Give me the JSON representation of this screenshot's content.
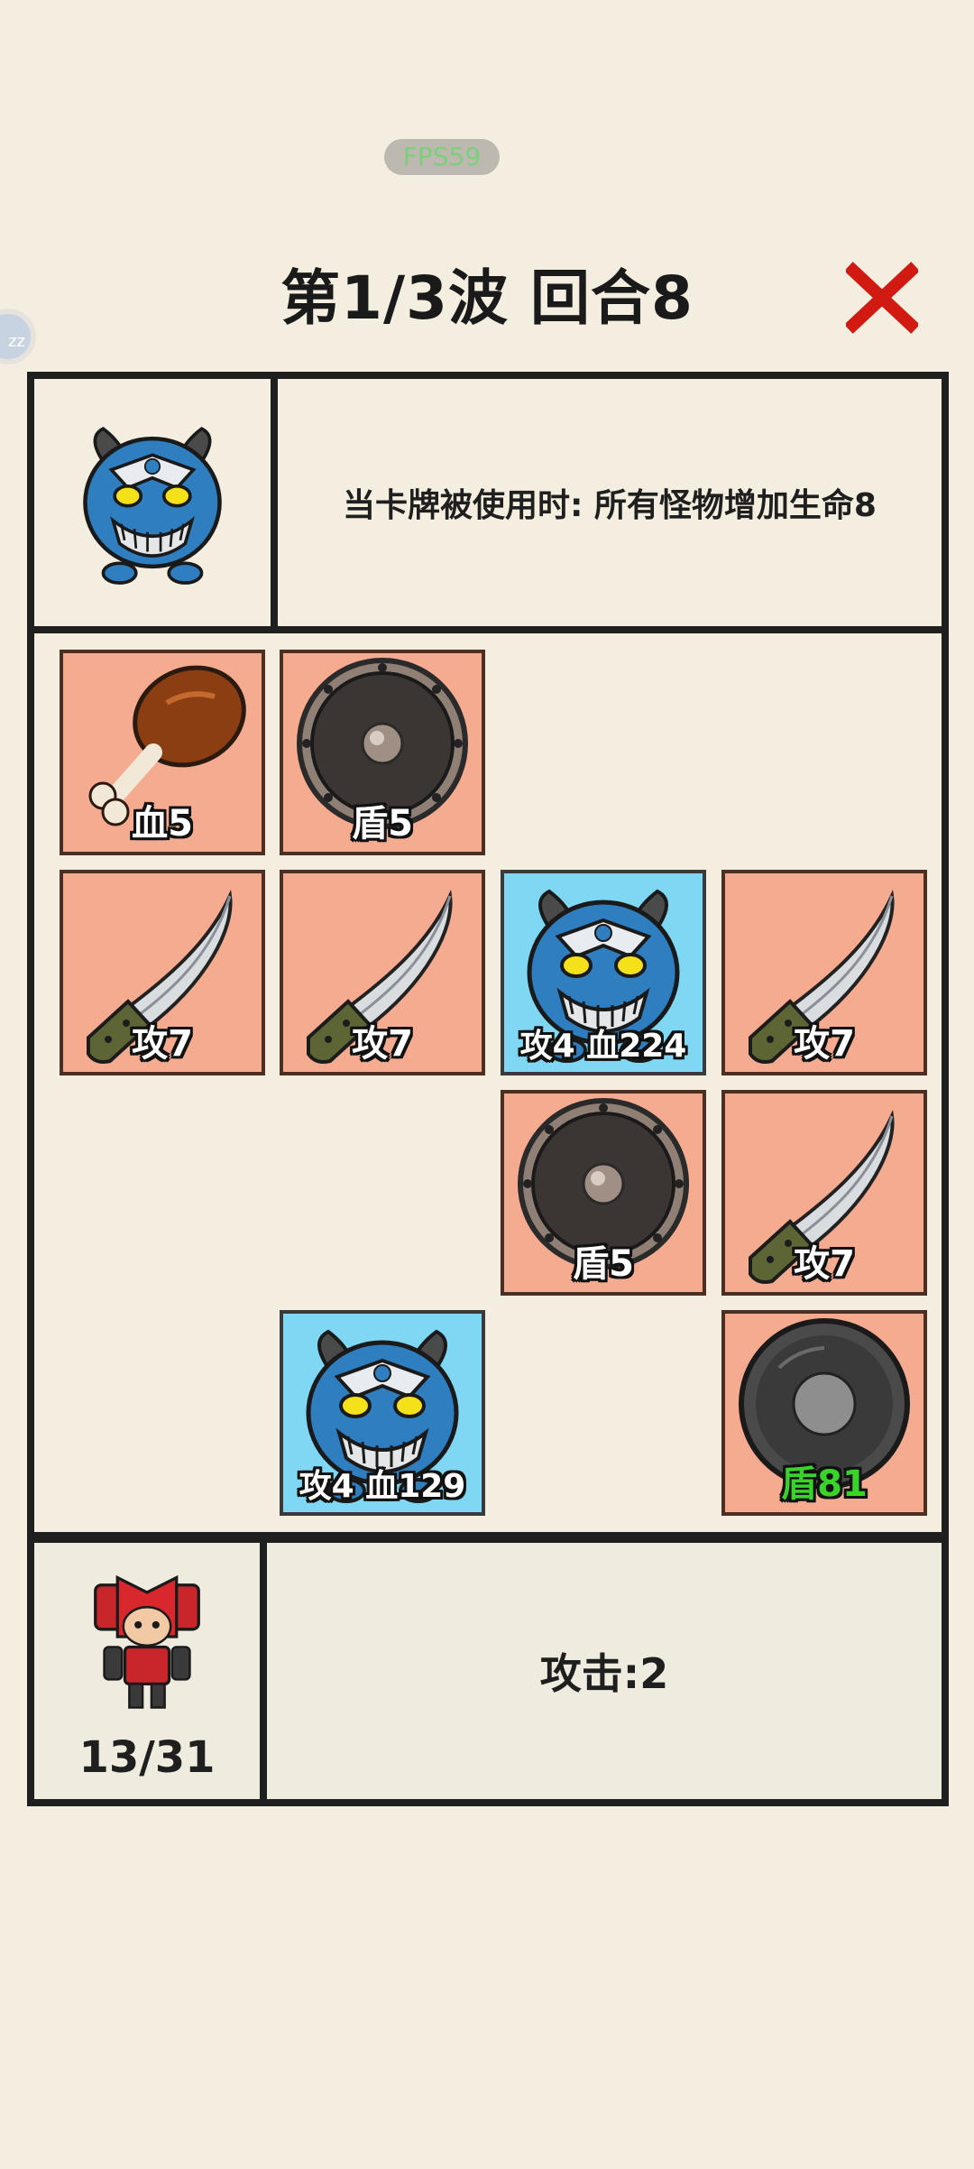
{
  "fps": "FPS59",
  "side_bubble": "zz",
  "title": "第1/3波  回合8",
  "top_panel": {
    "description": "当卡牌被使用时: 所有怪物增加生命8"
  },
  "cells": [
    {
      "icon": "drumstick-icon",
      "label": "血5"
    },
    {
      "icon": "shield-icon",
      "label": "盾5"
    },
    {
      "icon": "knife-icon",
      "label": "攻7"
    },
    {
      "icon": "knife-icon",
      "label": "攻7"
    },
    {
      "icon": "monster-icon",
      "label": "攻4  血224"
    },
    {
      "icon": "knife-icon",
      "label": "攻7"
    },
    {
      "icon": "shield-icon",
      "label": "盾5"
    },
    {
      "icon": "knife-icon",
      "label": "攻7"
    },
    {
      "icon": "monster-icon",
      "label": "攻4  血129"
    },
    {
      "icon": "dark-shield-icon",
      "label": "盾81"
    }
  ],
  "player": {
    "hp": "13/31"
  },
  "info": {
    "attack": "攻击:2"
  },
  "colors": {
    "background": "#f4eee0",
    "item_tile": "#f5ab90",
    "monster_tile": "#7fd7f3",
    "close": "#d01a12",
    "green_label": "#38d42a"
  }
}
